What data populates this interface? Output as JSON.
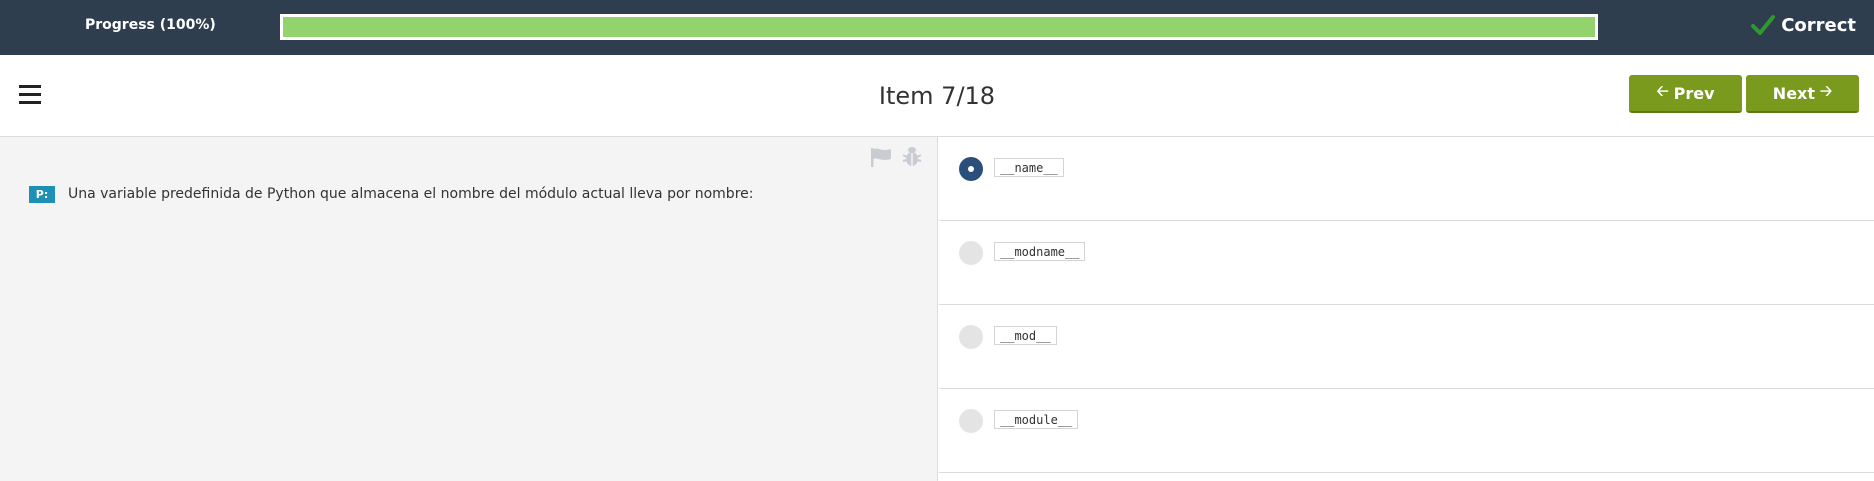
{
  "progress": {
    "label": "Progress (100%)",
    "fraction": 1.0
  },
  "status": {
    "text": "Correct",
    "color": "#2e9a2e"
  },
  "header": {
    "title": "Item 7/18",
    "prev_label": "Prev",
    "next_label": "Next",
    "menu_icon": "hamburger-icon"
  },
  "question": {
    "badge": "P:",
    "text": "Una variable predefinida de Python que almacena el nombre del módulo actual lleva por nombre:"
  },
  "options": [
    {
      "label": "__name__",
      "selected": true
    },
    {
      "label": "__modname__",
      "selected": false
    },
    {
      "label": "__mod__",
      "selected": false
    },
    {
      "label": "__module__",
      "selected": false
    }
  ],
  "colors": {
    "topbar": "#2f3e4e",
    "progress_fill": "#92d36e",
    "button": "#7a9a1e",
    "badge": "#1e8fb5",
    "radio_selected": "#2a4f7c"
  }
}
